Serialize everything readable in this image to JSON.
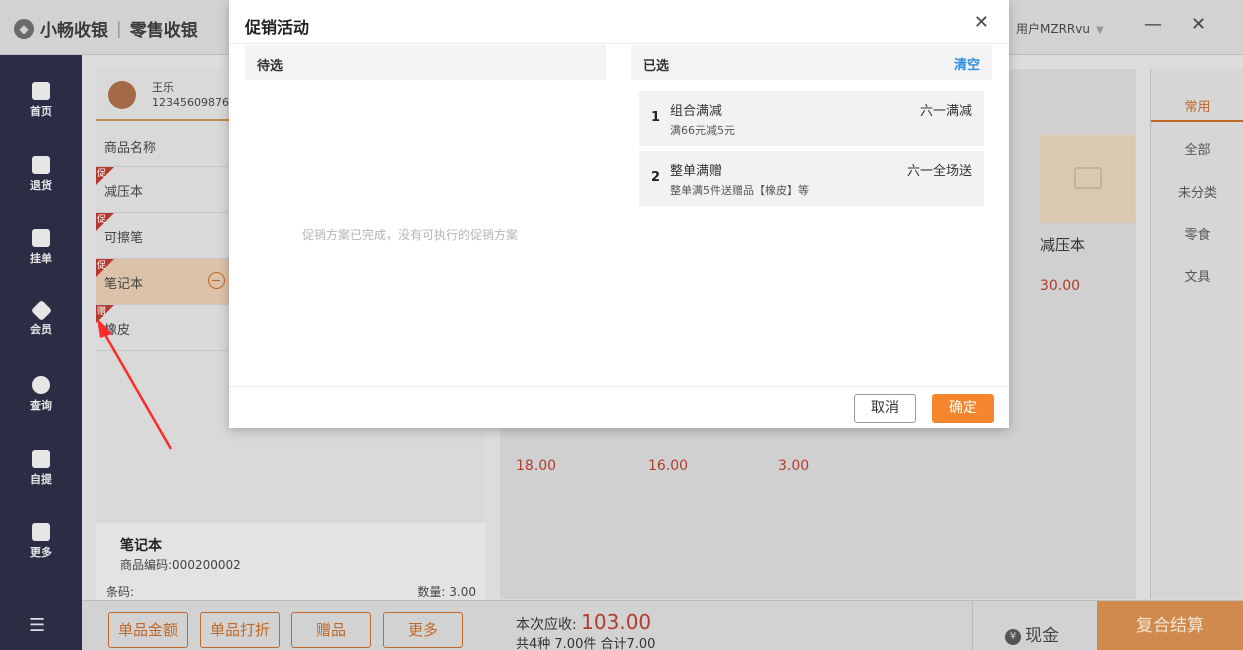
{
  "app": {
    "logo_text": "小畅收银",
    "mode_text": "零售收银",
    "user": "用户MZRRvu",
    "minimize": "—",
    "close": "✕"
  },
  "sidenav": [
    {
      "label": "首页",
      "icon": "home-icon"
    },
    {
      "label": "退货",
      "icon": "return-icon"
    },
    {
      "label": "挂单",
      "icon": "hold-order-icon"
    },
    {
      "label": "会员",
      "icon": "member-diamond-icon"
    },
    {
      "label": "查询",
      "icon": "search-icon"
    },
    {
      "label": "自提",
      "icon": "bag-icon"
    },
    {
      "label": "更多",
      "icon": "grid-icon"
    }
  ],
  "member": {
    "name": "王乐",
    "phone": "12345609876"
  },
  "product_list": {
    "header": "商品名称",
    "items": [
      {
        "name": "减压本",
        "tag": "促",
        "selected": false
      },
      {
        "name": "可擦笔",
        "tag": "促",
        "selected": false
      },
      {
        "name": "笔记本",
        "tag": "促",
        "selected": true
      },
      {
        "name": "橡皮",
        "tag": "赠",
        "selected": false
      }
    ]
  },
  "detail": {
    "name": "笔记本",
    "code": "商品编码:000200002",
    "barcode_label": "条码:",
    "quantity": "数量: 3.00"
  },
  "goods_card": {
    "name": "减压本",
    "price": "30.00"
  },
  "row_prices": [
    "18.00",
    "16.00",
    "3.00"
  ],
  "categories": [
    "常用",
    "全部",
    "未分类",
    "零食",
    "文具"
  ],
  "bottom": {
    "buttons": [
      "单品金额",
      "单品打折",
      "赠品",
      "更多"
    ],
    "due_label": "本次应收:",
    "due_amount": "103.00",
    "summary": "共4种 7.00件 合计7.00",
    "cash": "现金",
    "combo": "复合结算"
  },
  "modal": {
    "title": "促销活动",
    "close": "✕",
    "pending_header": "待选",
    "selected_header": "已选",
    "clear": "清空",
    "empty_message": "促销方案已完成，没有可执行的促销方案",
    "selected": [
      {
        "no": "1",
        "name": "组合满减",
        "type": "六一满减",
        "desc": "满66元减5元"
      },
      {
        "no": "2",
        "name": "整单满赠",
        "type": "六一全场送",
        "desc": "整单满5件送赠品【橡皮】等"
      }
    ],
    "cancel": "取消",
    "confirm": "确定"
  },
  "colors": {
    "accent": "#f5862e",
    "link": "#2c8de0",
    "nav": "#2b2d45",
    "annotation_arrow": "#ff2a2a"
  }
}
